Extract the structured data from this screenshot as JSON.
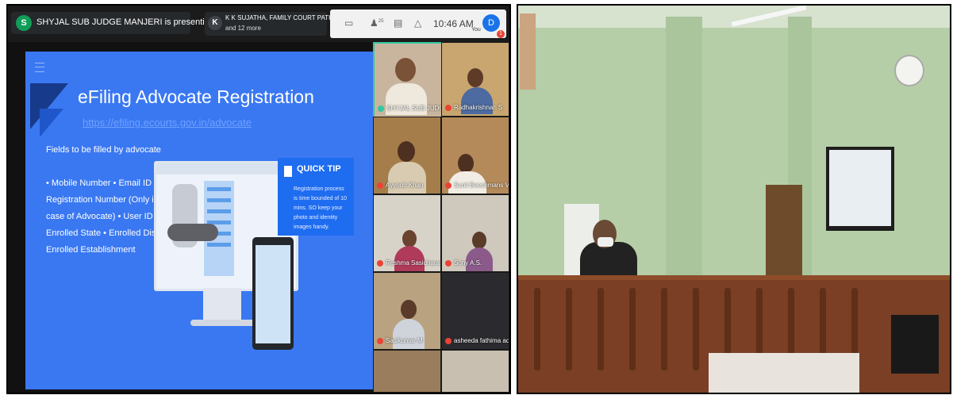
{
  "meeting": {
    "presenter": {
      "avatar_letter": "S",
      "text": "SHYJAL SUB JUDGE MANJERI is presenting"
    },
    "active_speaker": {
      "avatar_letter": "K",
      "name": "K K SUJATHA, FAMILY COURT PATHANAMTH...",
      "more": "and 12 more"
    },
    "controls": {
      "people_count": "25",
      "clock": "10:46 AM",
      "self_avatar": "D",
      "self_label": "You",
      "notification_count": "1"
    }
  },
  "slide": {
    "title": "eFiling Advocate Registration",
    "link": "https://efiling.ecourts.gov.in/advocate",
    "fields_heading": "Fields to be filled by advocate",
    "fields_list": "• Mobile Number • Email ID • Bar Registration Number (Only in case of Advocate) • User ID • Enrolled State • Enrolled District • Enrolled Establishment",
    "quick_tip_title": "QUICK TIP",
    "quick_tip_body": "Registration process is time bounded of 10 mins. SO keep your photo and identity images handy."
  },
  "participants": [
    {
      "name": "SHYJAL SUB JUDGE ...",
      "speaking": true
    },
    {
      "name": "Radhakrishnan S",
      "speaking": false
    },
    {
      "name": "Ayyoob Khan",
      "speaking": false
    },
    {
      "name": "Sunil Beechmans Var...",
      "speaking": false
    },
    {
      "name": "Reshma Sasidharan",
      "speaking": false
    },
    {
      "name": "Sony A.S.",
      "speaking": false
    },
    {
      "name": "Sasikumar M",
      "speaking": false
    },
    {
      "name": "asheeda fathima add...",
      "speaking": false
    }
  ],
  "icons": [
    "present-icon",
    "people-icon",
    "chat-icon",
    "activities-icon",
    "mic-off-icon",
    "hamburger-icon",
    "quick-tip-icon"
  ],
  "colors": {
    "accent_slide": "#3a78f2",
    "speaking_border": "#34c7a1",
    "mic_muted": "#ea4335"
  }
}
